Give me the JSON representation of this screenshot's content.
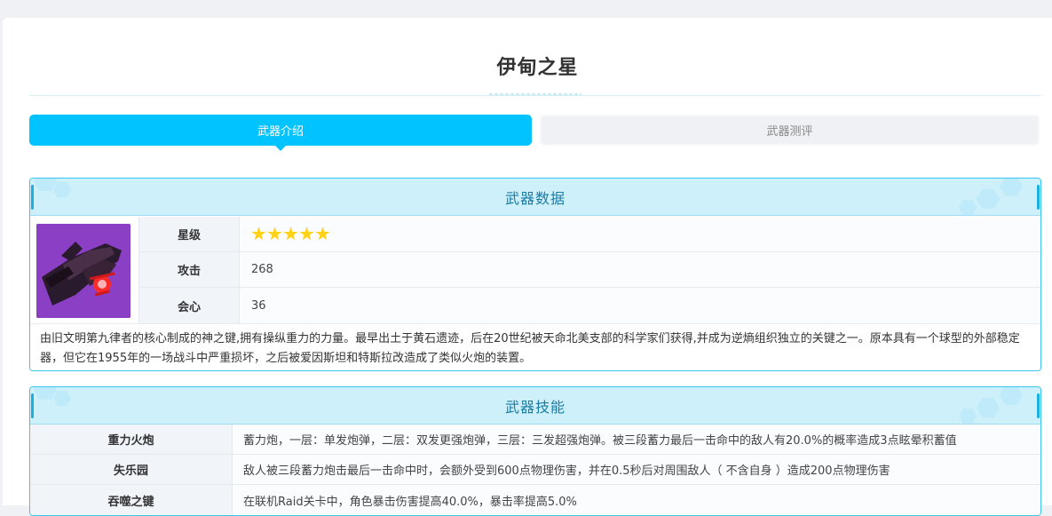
{
  "page": {
    "title": "伊甸之星"
  },
  "tabs": [
    {
      "label": "武器介绍",
      "active": true
    },
    {
      "label": "武器测评",
      "active": false
    }
  ],
  "weapon_data": {
    "heading": "武器数据",
    "image_icon": "weapon-portrait",
    "stats": [
      {
        "label": "星级",
        "value": "",
        "stars": 5
      },
      {
        "label": "攻击",
        "value": "268"
      },
      {
        "label": "会心",
        "value": "36"
      }
    ],
    "description": "由旧文明第九律者的核心制成的神之键,拥有操纵重力的力量。最早出土于黄石遗迹，后在20世纪被天命北美支部的科学家们获得,并成为逆熵组织独立的关键之一。原本具有一个球型的外部稳定器，但它在1955年的一场战斗中严重损坏，之后被爱因斯坦和特斯拉改造成了类似火炮的装置。"
  },
  "weapon_skills": {
    "heading": "武器技能",
    "rows": [
      {
        "name": "重力火炮",
        "desc": "蓄力炮，一层：单发炮弹，二层：双发更强炮弹，三层：三发超强炮弹。被三段蓄力最后一击命中的敌人有20.0%的概率造成3点眩晕积蓄值"
      },
      {
        "name": "失乐园",
        "desc": "敌人被三段蓄力炮击最后一击命中时，会额外受到600点物理伤害，并在0.5秒后对周围敌人（ 不含自身 ）造成200点物理伤害"
      },
      {
        "name": "吞噬之键",
        "desc": "在联机Raid关卡中，角色暴击伤害提高40.0%，暴击率提高5.0%"
      }
    ]
  },
  "colors": {
    "accent": "#00c3ff",
    "panel_border": "#39c5ec",
    "panel_head_bg": "#cdf0fb",
    "panel_head_text": "#1a7ca4",
    "star": "#ffd21a",
    "weapon_bg": "#8b3fc4"
  }
}
